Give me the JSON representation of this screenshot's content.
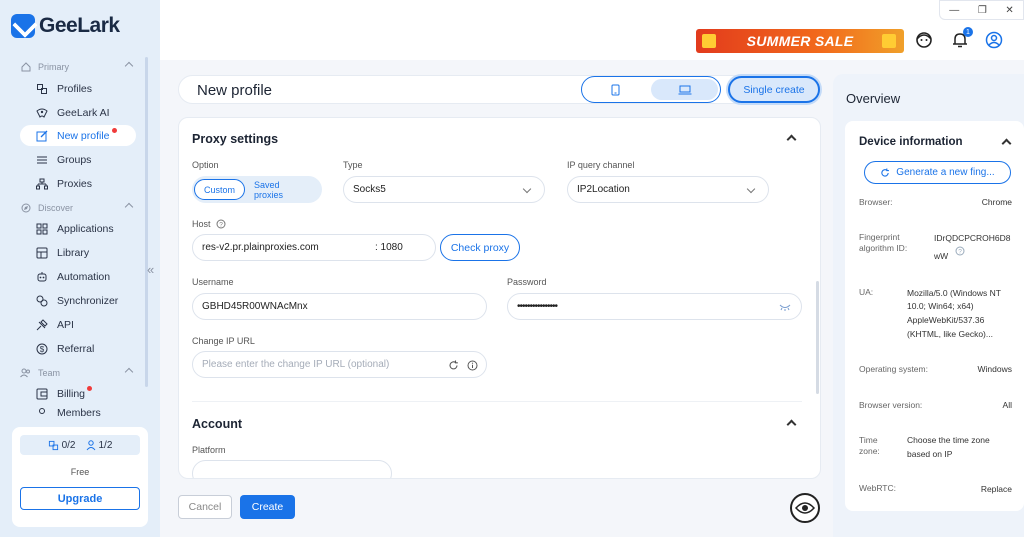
{
  "app": {
    "name": "GeeLark"
  },
  "sidebar": {
    "sections": [
      {
        "label": "Primary",
        "items": [
          {
            "label": "Profiles",
            "icon": "profiles-icon"
          },
          {
            "label": "GeeLark AI",
            "icon": "ai-icon"
          },
          {
            "label": "New profile",
            "icon": "new-profile-icon",
            "active": true,
            "dot": true
          },
          {
            "label": "Groups",
            "icon": "groups-icon"
          },
          {
            "label": "Proxies",
            "icon": "proxies-icon"
          }
        ]
      },
      {
        "label": "Discover",
        "items": [
          {
            "label": "Applications",
            "icon": "applications-icon"
          },
          {
            "label": "Library",
            "icon": "library-icon"
          },
          {
            "label": "Automation",
            "icon": "automation-icon"
          },
          {
            "label": "Synchronizer",
            "icon": "synchronizer-icon"
          },
          {
            "label": "API",
            "icon": "api-icon"
          },
          {
            "label": "Referral",
            "icon": "referral-icon"
          }
        ]
      },
      {
        "label": "Team",
        "items": [
          {
            "label": "Billing",
            "icon": "billing-icon",
            "dot": true
          },
          {
            "label": "Members",
            "icon": "members-icon"
          }
        ]
      }
    ],
    "plan": {
      "profiles_count": "0/2",
      "members_count": "1/2",
      "name": "Free",
      "upgrade_label": "Upgrade"
    }
  },
  "topbar": {
    "sale_label": "SUMMER SALE",
    "notification_count": "1"
  },
  "profile": {
    "title": "New profile",
    "single_create_label": "Single create"
  },
  "proxy": {
    "section_title": "Proxy settings",
    "option_label": "Option",
    "option_custom": "Custom",
    "option_saved": "Saved proxies",
    "type_label": "Type",
    "type_value": "Socks5",
    "ip_query_label": "IP query channel",
    "ip_query_value": "IP2Location",
    "host_label": "Host",
    "host_value": "res-v2.pr.plainproxies.com",
    "port_value": ": 1080",
    "check_label": "Check proxy",
    "username_label": "Username",
    "username_value": "GBHD45R00WNAcMnx",
    "password_label": "Password",
    "password_value": "••••••••••••••••",
    "change_ip_label": "Change IP URL",
    "change_ip_placeholder": "Please enter the change IP URL (optional)"
  },
  "account": {
    "section_title": "Account",
    "platform_label": "Platform"
  },
  "actions": {
    "cancel_label": "Cancel",
    "create_label": "Create"
  },
  "overview": {
    "title": "Overview",
    "device_title": "Device information",
    "generate_label": "Generate a new fing...",
    "rows": {
      "browser_k": "Browser:",
      "browser_v": "Chrome",
      "fp_k1": "Fingerprint",
      "fp_k2": "algorithm ID:",
      "fp_v1": "IDrQDCPCROH6D8",
      "fp_v2": "wW",
      "ua_k": "UA:",
      "ua_v1": "Mozilla/5.0 (Windows NT",
      "ua_v2": "10.0; Win64; x64)",
      "ua_v3": "AppleWebKit/537.36",
      "ua_v4": "(KHTML, like Gecko)...",
      "os_k": "Operating system:",
      "os_v": "Windows",
      "bv_k": "Browser version:",
      "bv_v": "All",
      "tz_k1": "Time",
      "tz_k2": "zone:",
      "tz_v1": "Choose the time zone",
      "tz_v2": "based on IP",
      "rtc_k": "WebRTC:",
      "rtc_v": "Replace"
    }
  }
}
